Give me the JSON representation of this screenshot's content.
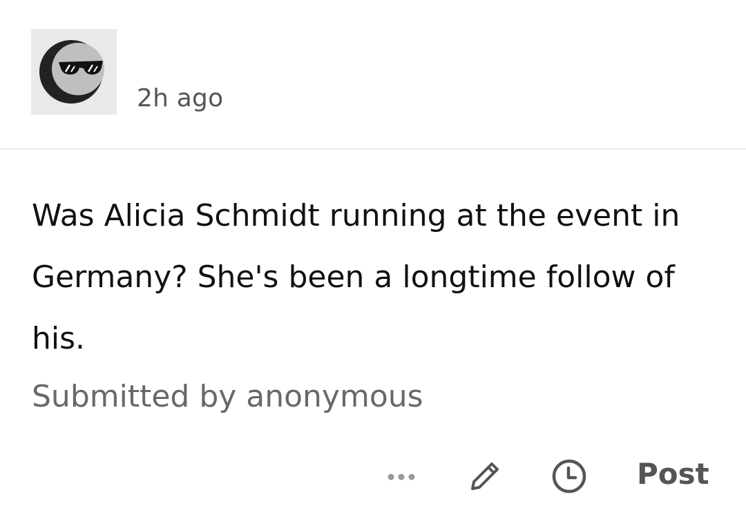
{
  "post": {
    "avatar_icon": "sunglasses-moon-avatar-icon",
    "timestamp": "2h ago",
    "question": "Was Alicia Schmidt running at the event in Germany? She's been a longtime follow of his.",
    "submitted_by": "Submitted by anonymous"
  },
  "actions": {
    "more_icon": "more-dots-icon",
    "edit_icon": "pencil-icon",
    "schedule_icon": "clock-icon",
    "post_label": "Post"
  },
  "colors": {
    "text_primary": "#111111",
    "text_secondary": "#686868",
    "icon_gray": "#555555",
    "avatar_bg": "#e9e9e9",
    "divider": "#ececec"
  }
}
